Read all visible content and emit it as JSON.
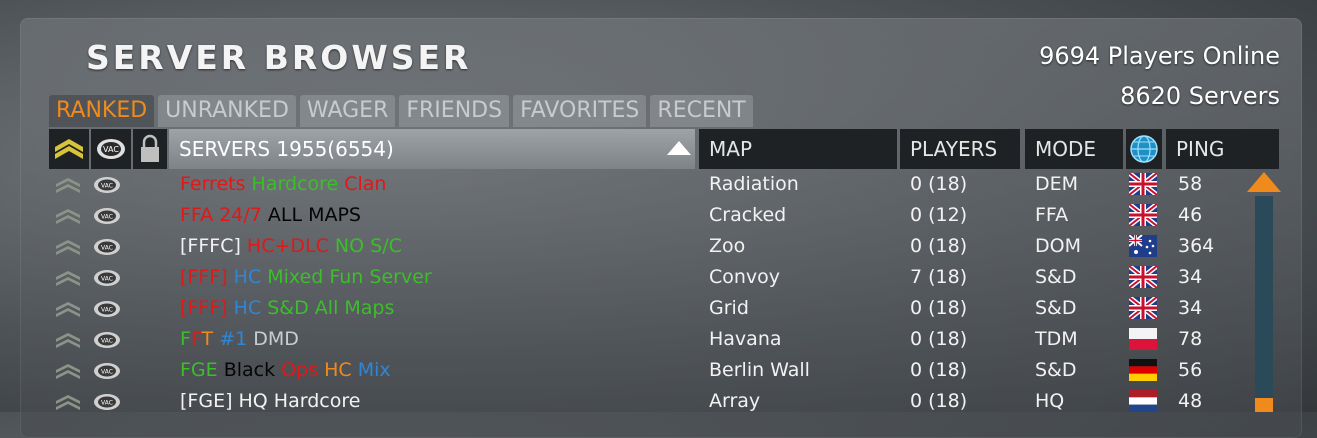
{
  "title": "SERVER BROWSER",
  "stats": {
    "players_online": "9694 Players Online",
    "servers": "8620 Servers"
  },
  "tabs": [
    {
      "label": "RANKED",
      "active": true
    },
    {
      "label": "UNRANKED",
      "active": false
    },
    {
      "label": "WAGER",
      "active": false
    },
    {
      "label": "FRIENDS",
      "active": false
    },
    {
      "label": "FAVORITES",
      "active": false
    },
    {
      "label": "RECENT",
      "active": false
    }
  ],
  "columns": {
    "servers": "SERVERS 1955(6554)",
    "map": "MAP",
    "players": "PLAYERS",
    "mode": "MODE",
    "ping": "PING"
  },
  "icons": {
    "rank": "sergeant-chevron-icon",
    "vac": "vac-icon",
    "lock": "lock-icon",
    "region": "globe-icon"
  },
  "colors": {
    "accent": "#f08a1c",
    "red": "#e01818",
    "green": "#3cbd2a",
    "blue": "#2f86d6",
    "orange": "#f08a1c",
    "black": "#050505",
    "white": "#f2f2f2",
    "grey": "#c9ccd0"
  },
  "rows": [
    {
      "name": [
        {
          "t": "Ferrets ",
          "c": "red"
        },
        {
          "t": "Hardcore ",
          "c": "green"
        },
        {
          "t": "Clan",
          "c": "red"
        }
      ],
      "map": "Radiation",
      "players": "0 (18)",
      "mode": "DEM",
      "flag": "uk",
      "ping": "58"
    },
    {
      "name": [
        {
          "t": "FFA 24/7 ",
          "c": "red"
        },
        {
          "t": "ALL MAPS",
          "c": "black"
        }
      ],
      "map": "Cracked",
      "players": "0 (12)",
      "mode": "FFA",
      "flag": "uk",
      "ping": "46"
    },
    {
      "name": [
        {
          "t": "[FFFC] ",
          "c": "white"
        },
        {
          "t": "HC+DLC ",
          "c": "red"
        },
        {
          "t": "NO S/C",
          "c": "green"
        }
      ],
      "map": "Zoo",
      "players": "0 (18)",
      "mode": "DOM",
      "flag": "au",
      "ping": "364"
    },
    {
      "name": [
        {
          "t": "[FFF] ",
          "c": "red"
        },
        {
          "t": "HC ",
          "c": "blue"
        },
        {
          "t": "Mixed Fun Server",
          "c": "green"
        }
      ],
      "map": "Convoy",
      "players": "7 (18)",
      "mode": "S&D",
      "flag": "uk",
      "ping": "34"
    },
    {
      "name": [
        {
          "t": "[FFF] ",
          "c": "red"
        },
        {
          "t": "HC ",
          "c": "blue"
        },
        {
          "t": "S&D All Maps",
          "c": "green"
        }
      ],
      "map": "Grid",
      "players": "0 (18)",
      "mode": "S&D",
      "flag": "uk",
      "ping": "34"
    },
    {
      "name": [
        {
          "t": "F",
          "c": "green"
        },
        {
          "t": "F",
          "c": "red"
        },
        {
          "t": "T ",
          "c": "orange"
        },
        {
          "t": "#1 ",
          "c": "blue"
        },
        {
          "t": "DMD",
          "c": "grey"
        }
      ],
      "map": "Havana",
      "players": "0 (18)",
      "mode": "TDM",
      "flag": "pl",
      "ping": "78"
    },
    {
      "name": [
        {
          "t": "FGE ",
          "c": "green"
        },
        {
          "t": "Black ",
          "c": "black"
        },
        {
          "t": "Ops ",
          "c": "red"
        },
        {
          "t": "HC ",
          "c": "orange"
        },
        {
          "t": "Mix",
          "c": "blue"
        }
      ],
      "map": "Berlin Wall",
      "players": "0 (18)",
      "mode": "S&D",
      "flag": "de",
      "ping": "56"
    },
    {
      "name": [
        {
          "t": "[FGE] HQ Hardcore",
          "c": "white"
        }
      ],
      "map": "Array",
      "players": "0 (18)",
      "mode": "HQ",
      "flag": "nl",
      "ping": "48"
    }
  ]
}
